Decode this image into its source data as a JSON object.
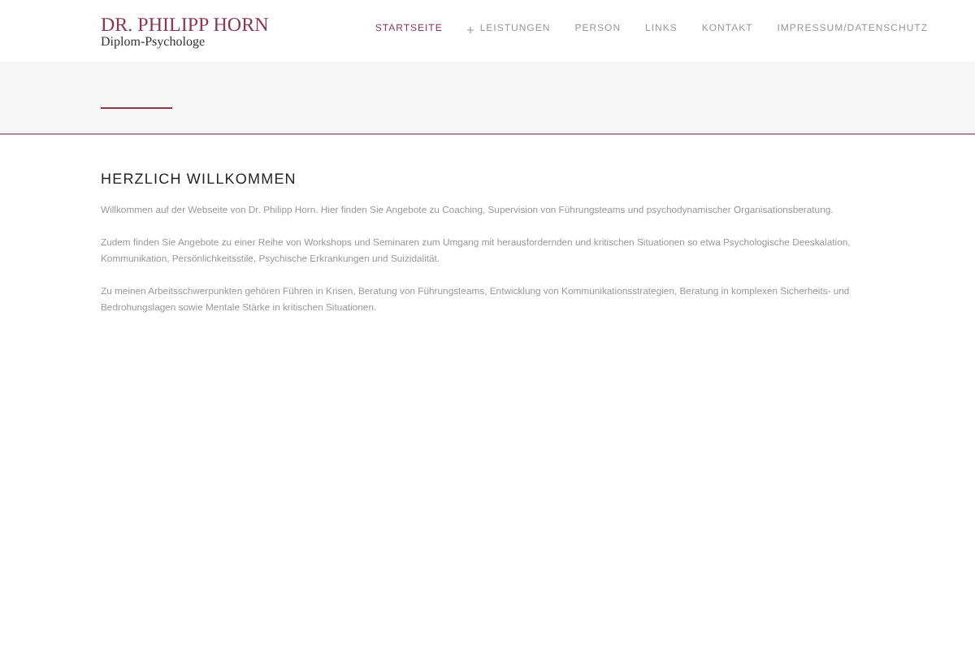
{
  "header": {
    "logo_title": "DR. PHILIPP HORN",
    "logo_subtitle": "Diplom-Psychologe"
  },
  "nav": [
    {
      "label": "STARTSEITE",
      "selected": true,
      "has_submenu": false
    },
    {
      "label": "LEISTUNGEN",
      "selected": false,
      "has_submenu": true
    },
    {
      "label": "PERSON",
      "selected": false,
      "has_submenu": false
    },
    {
      "label": "LINKS",
      "selected": false,
      "has_submenu": false
    },
    {
      "label": "KONTAKT",
      "selected": false,
      "has_submenu": false
    },
    {
      "label": "IMPRESSUM/DATENSCHUTZ",
      "selected": false,
      "has_submenu": false
    }
  ],
  "content": {
    "heading": "HERZLICH WILLKOMMEN",
    "paragraphs": [
      "Willkommen auf der Webseite von Dr. Philipp Horn. Hier finden Sie Angebote zu Coaching, Supervision von Führungsteams und psychodynamischer Organisationsberatung.",
      "Zudem finden Sie Angebote zu einer Reihe von Workshops und Seminaren zum Umgang mit herausfordernden und kritischen Situationen so etwa Psychologische Deeskalation, Kommunikation, Persönlichkeitsstile, Psychische Erkrankungen und Suizidalität.",
      "Zu meinen Arbeitsschwerpunkten gehören Führen in Krisen, Beratung von Führungsteams, Entwicklung von Kommunikationsstrategien,  Beratung in komplexen Sicherheits- und Bedrohungslagen sowie Mentale Stärke in kritischen Situationen."
    ]
  }
}
